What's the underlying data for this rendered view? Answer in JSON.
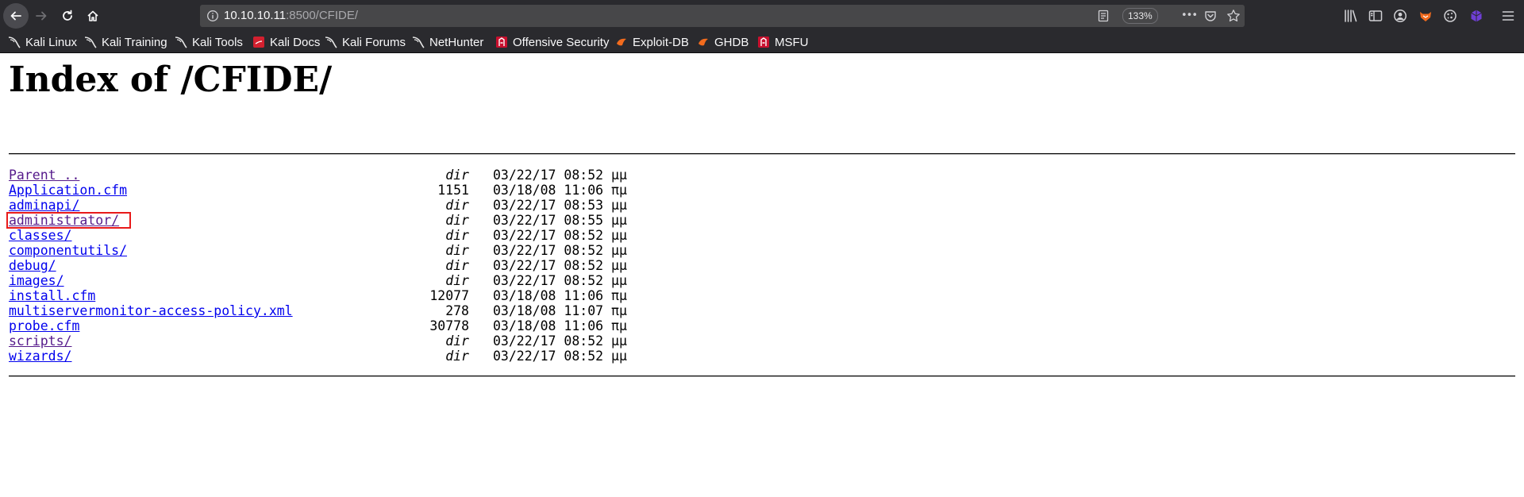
{
  "browser": {
    "url_host": "10.10.10.11",
    "url_rest": ":8500/CFIDE/",
    "zoom": "133%",
    "ellipsis": "•••"
  },
  "bookmarks": [
    {
      "label": "Kali Linux",
      "icon": "kali-dragon-icon"
    },
    {
      "label": "Kali Training",
      "icon": "kali-dragon-icon"
    },
    {
      "label": "Kali Tools",
      "icon": "kali-dragon-icon"
    },
    {
      "label": "Kali Docs",
      "icon": "kali-docs-icon"
    },
    {
      "label": "Kali Forums",
      "icon": "kali-dragon-icon"
    },
    {
      "label": "NetHunter",
      "icon": "kali-dragon-icon"
    },
    {
      "label": "Offensive Security",
      "icon": "offsec-icon"
    },
    {
      "label": "Exploit-DB",
      "icon": "exploitdb-icon"
    },
    {
      "label": "GHDB",
      "icon": "exploitdb-icon"
    },
    {
      "label": "MSFU",
      "icon": "offsec-icon"
    }
  ],
  "page": {
    "title": "Index of /CFIDE/",
    "entries": [
      {
        "name": "Parent ..",
        "size": "dir",
        "date": "03/22/17 08:52 μμ"
      },
      {
        "name": "Application.cfm",
        "size": "1151",
        "date": "03/18/08 11:06 πμ"
      },
      {
        "name": "adminapi/",
        "size": "dir",
        "date": "03/22/17 08:53 μμ"
      },
      {
        "name": "administrator/",
        "size": "dir",
        "date": "03/22/17 08:55 μμ"
      },
      {
        "name": "classes/",
        "size": "dir",
        "date": "03/22/17 08:52 μμ"
      },
      {
        "name": "componentutils/",
        "size": "dir",
        "date": "03/22/17 08:52 μμ"
      },
      {
        "name": "debug/",
        "size": "dir",
        "date": "03/22/17 08:52 μμ"
      },
      {
        "name": "images/",
        "size": "dir",
        "date": "03/22/17 08:52 μμ"
      },
      {
        "name": "install.cfm",
        "size": "12077",
        "date": "03/18/08 11:06 πμ"
      },
      {
        "name": "multiservermonitor-access-policy.xml",
        "size": "278",
        "date": "03/18/08 11:07 πμ"
      },
      {
        "name": "probe.cfm",
        "size": "30778",
        "date": "03/18/08 11:06 πμ"
      },
      {
        "name": "scripts/",
        "size": "dir",
        "date": "03/22/17 08:52 μμ"
      },
      {
        "name": "wizards/",
        "size": "dir",
        "date": "03/22/17 08:52 μμ"
      }
    ]
  },
  "colors": {
    "link": "#0000ee",
    "visited_link": "#551a8b",
    "highlight": "#e81a1a",
    "chrome": "#2a2a2e"
  }
}
